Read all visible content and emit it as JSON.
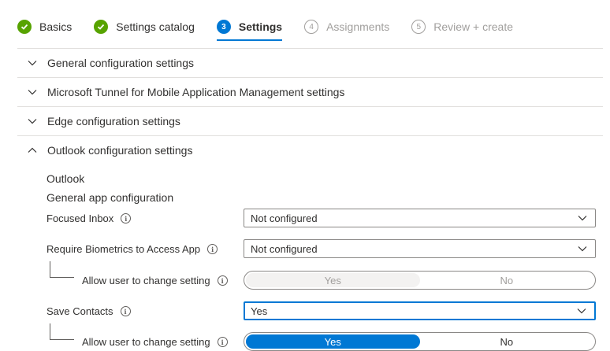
{
  "wizard": {
    "steps": [
      {
        "label": "Basics",
        "state": "done"
      },
      {
        "label": "Settings catalog",
        "state": "done"
      },
      {
        "label": "Settings",
        "state": "current",
        "number": "3"
      },
      {
        "label": "Assignments",
        "state": "future",
        "number": "4"
      },
      {
        "label": "Review + create",
        "state": "future",
        "number": "5"
      }
    ]
  },
  "sections": [
    {
      "title": "General configuration settings",
      "expanded": false
    },
    {
      "title": "Microsoft Tunnel for Mobile Application Management settings",
      "expanded": false
    },
    {
      "title": "Edge configuration settings",
      "expanded": false
    },
    {
      "title": "Outlook configuration settings",
      "expanded": true
    }
  ],
  "outlook": {
    "heading": "Outlook",
    "subheading": "General app configuration",
    "focused_inbox": {
      "label": "Focused Inbox",
      "value": "Not configured"
    },
    "require_biometrics": {
      "label": "Require Biometrics to Access App",
      "value": "Not configured"
    },
    "biometrics_allow_user": {
      "label": "Allow user to change setting",
      "yes": "Yes",
      "no": "No",
      "selected": "Yes",
      "enabled": false
    },
    "save_contacts": {
      "label": "Save Contacts",
      "value": "Yes"
    },
    "contacts_allow_user": {
      "label": "Allow user to change setting",
      "yes": "Yes",
      "no": "No",
      "selected": "Yes",
      "enabled": true
    }
  },
  "colors": {
    "accent": "#0078d4",
    "done": "#57a300",
    "muted": "#a19f9d"
  }
}
